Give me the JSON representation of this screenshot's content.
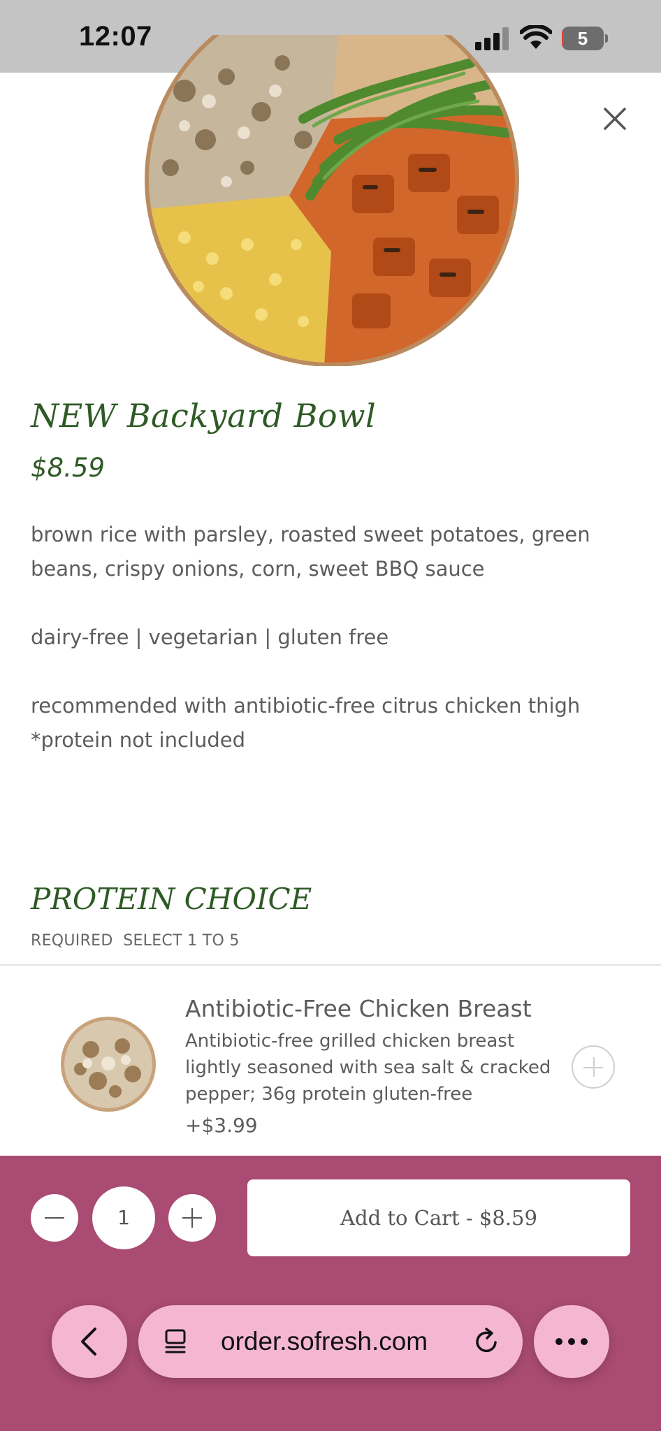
{
  "status_bar": {
    "time": "12:07",
    "battery_level": "5",
    "icons": [
      "cellular-signal-icon",
      "wifi-icon",
      "battery-icon"
    ]
  },
  "product": {
    "title": "NEW Backyard Bowl",
    "price": "$8.59",
    "description": "brown rice with parsley, roasted sweet potatoes, green beans, crispy onions, corn, sweet BBQ sauce",
    "dietary": "dairy-free | vegetarian | gluten free",
    "recommendation": "recommended with antibiotic-free citrus chicken thigh *protein not included",
    "image": "backyard-bowl-image"
  },
  "protein_section": {
    "title": "PROTEIN CHOICE",
    "subtitle": "REQUIRED  SELECT 1 TO 5",
    "options": [
      {
        "name": "Antibiotic-Free Chicken Breast",
        "description": "Antibiotic-free grilled chicken breast lightly seasoned with sea salt & cracked pepper; 36g protein  gluten-free",
        "price": "+$3.99",
        "image": "chicken-breast-image"
      }
    ]
  },
  "cart": {
    "quantity": "1",
    "add_label": "Add to Cart - $8.59"
  },
  "browser": {
    "url": "order.sofresh.com",
    "icons": [
      "back-chevron-icon",
      "tab-overview-icon",
      "reload-icon",
      "more-dots-icon"
    ]
  },
  "colors": {
    "title_green": "#2e5a25",
    "bottom_panel": "#a94b72",
    "browser_pill": "#f5b6d3",
    "status_bar": "#c4c4c4"
  }
}
